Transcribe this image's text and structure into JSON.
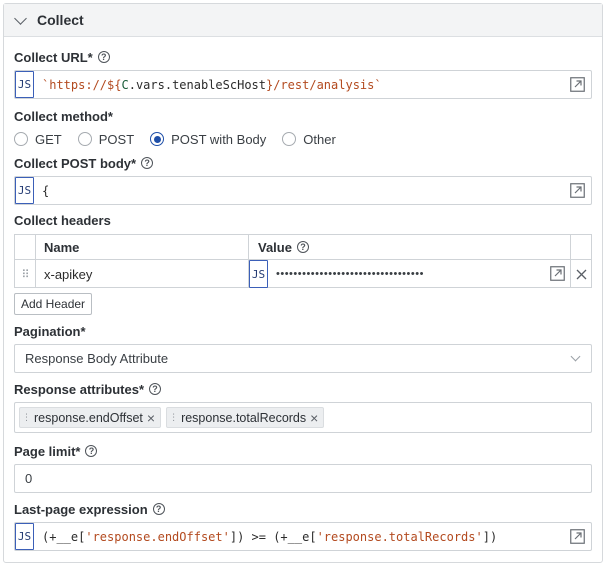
{
  "panel": {
    "title": "Collect"
  },
  "collect_url": {
    "label": "Collect URL*",
    "badge": "JS",
    "value_parts": [
      "`https://${",
      "C",
      ".vars.tenableScHost",
      "}",
      "/rest/analysis",
      "`"
    ]
  },
  "collect_method": {
    "label": "Collect method*",
    "options": [
      "GET",
      "POST",
      "POST with Body",
      "Other"
    ],
    "selected": "POST with Body"
  },
  "post_body": {
    "label": "Collect POST body*",
    "badge": "JS",
    "value": "{"
  },
  "headers": {
    "label": "Collect headers",
    "col_name": "Name",
    "col_value": "Value",
    "rows": [
      {
        "name": "x-apikey",
        "badge": "JS",
        "value": "••••••••••••••••••••••••••••••••••"
      }
    ],
    "add_button": "Add Header"
  },
  "pagination": {
    "label": "Pagination*",
    "value": "Response Body Attribute"
  },
  "response_attributes": {
    "label": "Response attributes*",
    "tags": [
      "response.endOffset",
      "response.totalRecords"
    ]
  },
  "page_limit": {
    "label": "Page limit*",
    "value": "0"
  },
  "last_page": {
    "label": "Last-page expression",
    "badge": "JS",
    "value_parts": [
      "(+__e[",
      "'response.endOffset'",
      "]) >= (+__e[",
      "'response.totalRecords'",
      "])"
    ]
  },
  "colors": {
    "accent": "#1f4fa8",
    "badge_border": "#3b5fb8",
    "string": "#b34a1f"
  }
}
